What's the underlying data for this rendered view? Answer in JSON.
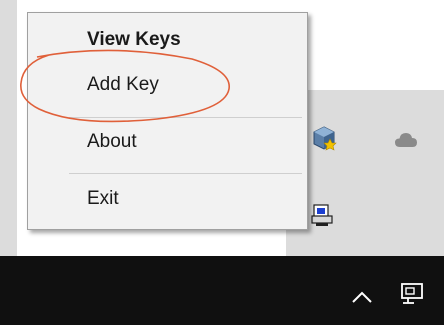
{
  "menu": {
    "items": [
      {
        "label": "View Keys",
        "bold": true
      },
      {
        "label": "Add Key",
        "bold": false
      },
      {
        "label": "About",
        "bold": false
      },
      {
        "label": "Exit",
        "bold": false
      }
    ]
  },
  "tray": {
    "icons": [
      "virtualbox-icon",
      "onedrive-cloud-icon",
      "network-printer-icon"
    ]
  },
  "taskbar": {
    "icons": [
      "chevron-up-icon",
      "network-monitor-icon"
    ]
  },
  "colors": {
    "menu_bg": "#f2f2f2",
    "taskbar_bg": "#101010",
    "annotation": "#e0603a"
  }
}
